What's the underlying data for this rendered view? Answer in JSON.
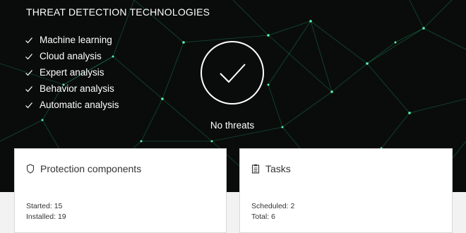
{
  "hero": {
    "title": "THREAT DETECTION TECHNOLOGIES",
    "technologies": [
      "Machine learning",
      "Cloud analysis",
      "Expert analysis",
      "Behavior analysis",
      "Automatic analysis"
    ],
    "status": "No threats",
    "accent_color": "#1fbf7a"
  },
  "cards": {
    "protection": {
      "icon": "shield-icon",
      "title": "Protection components",
      "started_label": "Started:",
      "started_value": "15",
      "installed_label": "Installed:",
      "installed_value": "19"
    },
    "tasks": {
      "icon": "clipboard-icon",
      "title": "Tasks",
      "scheduled_label": "Scheduled:",
      "scheduled_value": "2",
      "total_label": "Total:",
      "total_value": "6"
    }
  }
}
